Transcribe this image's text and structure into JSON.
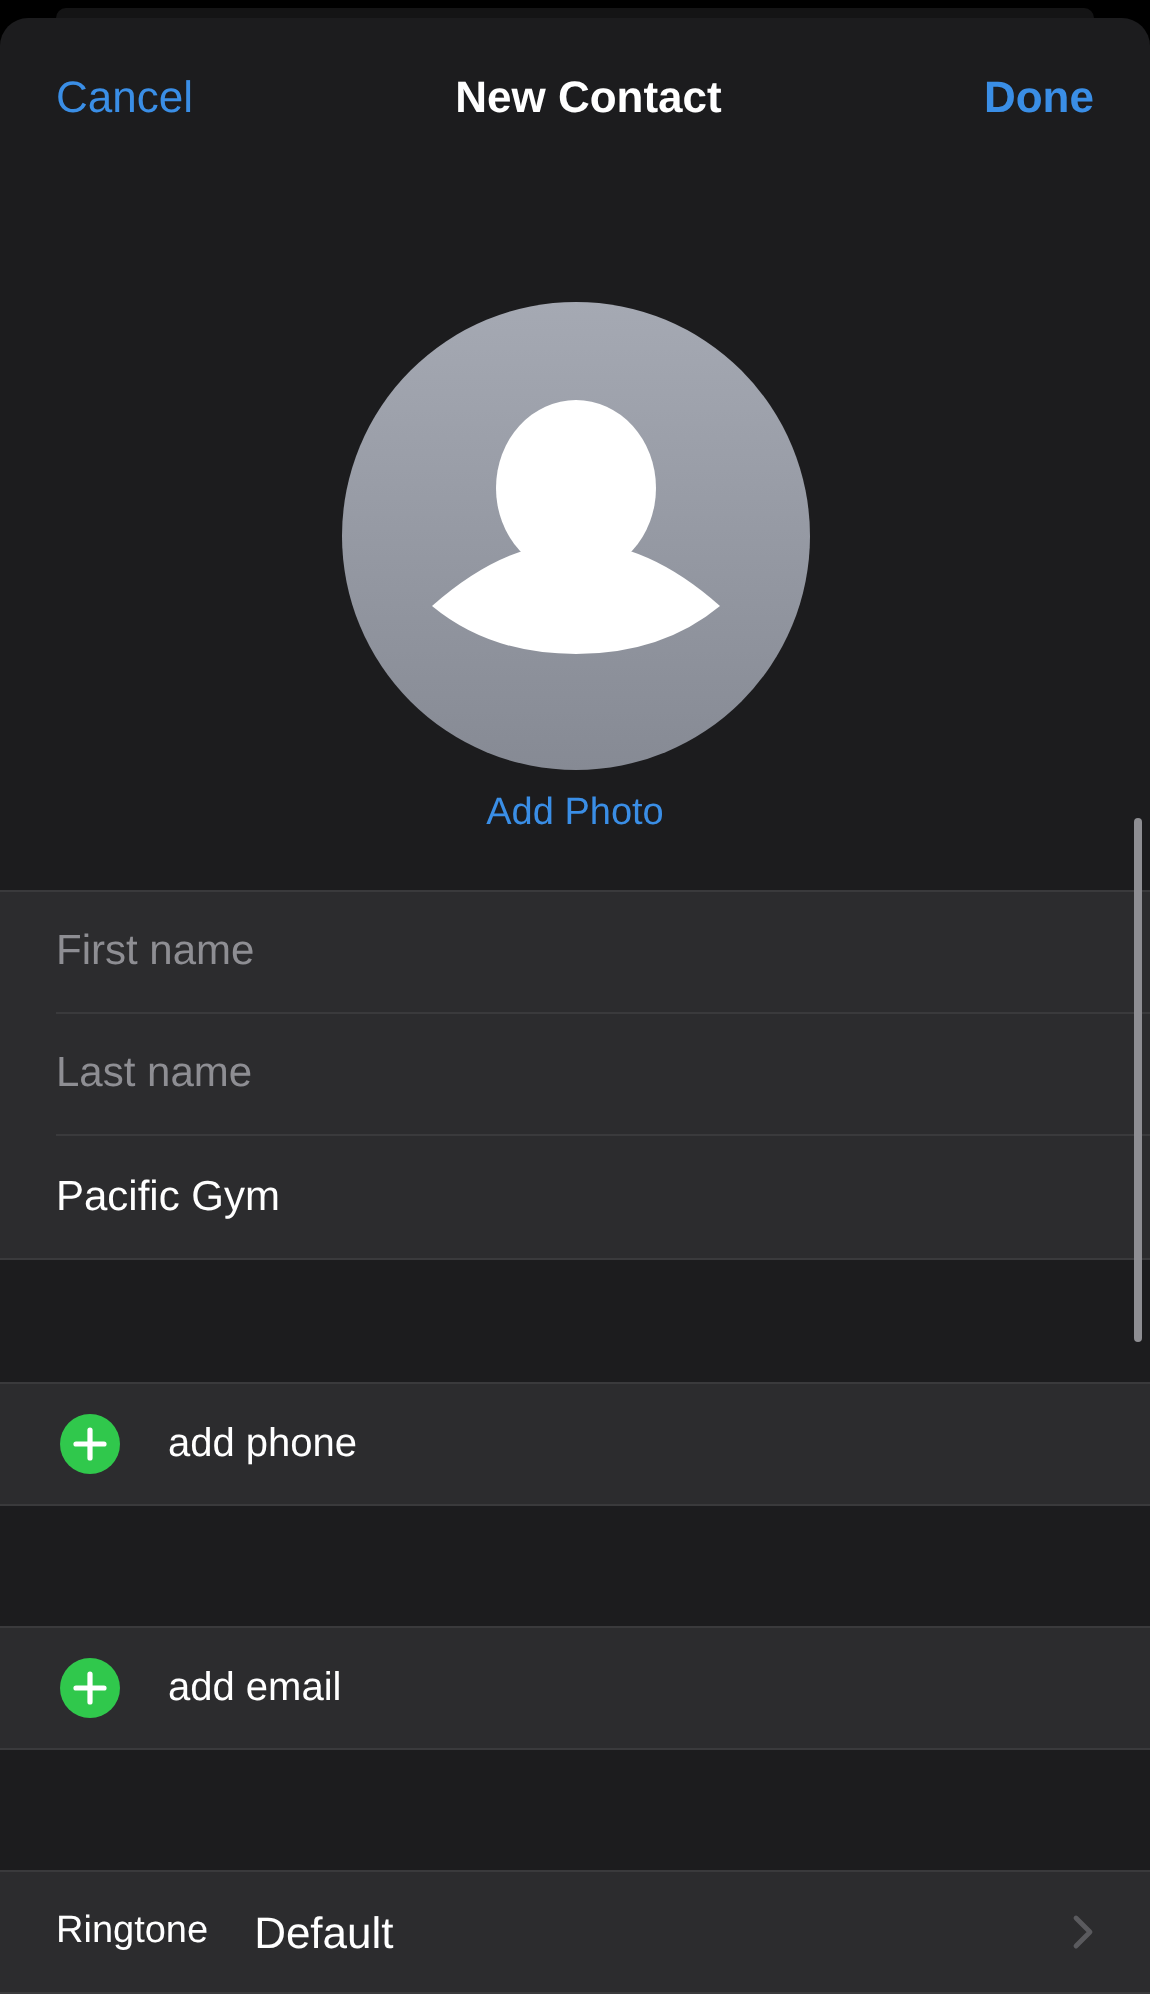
{
  "nav": {
    "cancel": "Cancel",
    "title": "New Contact",
    "done": "Done"
  },
  "photo": {
    "action": "Add Photo"
  },
  "name_fields": [
    {
      "placeholder": "First name"
    },
    {
      "placeholder": "Last name"
    },
    {
      "value": "Pacific Gym"
    }
  ],
  "add_rows": [
    {
      "label": "add phone"
    },
    {
      "label": "add email"
    }
  ],
  "ringtone": {
    "label": "Ringtone",
    "value": "Default"
  }
}
